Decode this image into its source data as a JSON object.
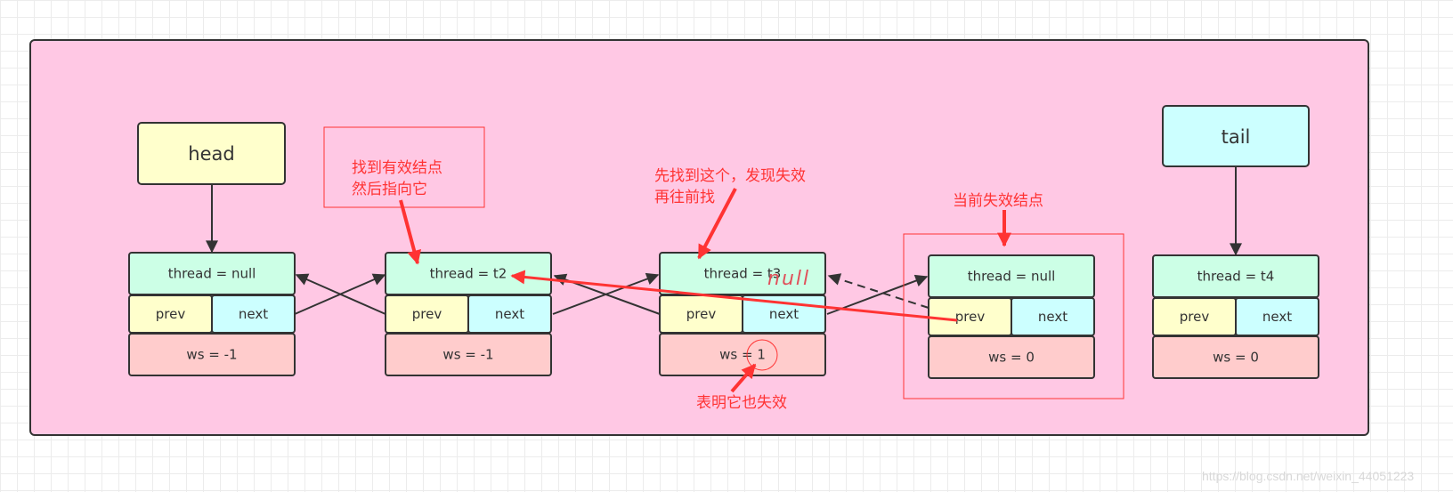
{
  "colors": {
    "container": "#ffc8e4",
    "thread": "#ccffe6",
    "prev": "#ffffcc",
    "next": "#ccffff",
    "ws": "#ffcccc",
    "head": "#ffffcc",
    "tail": "#ccffff",
    "annotation": "#ff3333"
  },
  "head": {
    "label": "head"
  },
  "tail": {
    "label": "tail"
  },
  "nodes": [
    {
      "thread": "thread = null",
      "prev": "prev",
      "next": "next",
      "ws": "ws = -1"
    },
    {
      "thread": "thread = t2",
      "prev": "prev",
      "next": "next",
      "ws": "ws = -1"
    },
    {
      "thread": "thread = t3",
      "prev": "prev",
      "next": "next",
      "ws": "ws = 1",
      "handwritten": "null"
    },
    {
      "thread": "thread = null",
      "prev": "prev",
      "next": "next",
      "ws": "ws = 0"
    },
    {
      "thread": "thread = t4",
      "prev": "prev",
      "next": "next",
      "ws": "ws = 0"
    }
  ],
  "annotations": {
    "find_valid": [
      "找到有效结点",
      "然后指向它"
    ],
    "find_first": [
      "先找到这个，发现失效",
      "再往前找"
    ],
    "current_invalid": "当前失效结点",
    "also_invalid": "表明它也失效"
  },
  "watermark": "https://blog.csdn.net/weixin_44051223"
}
